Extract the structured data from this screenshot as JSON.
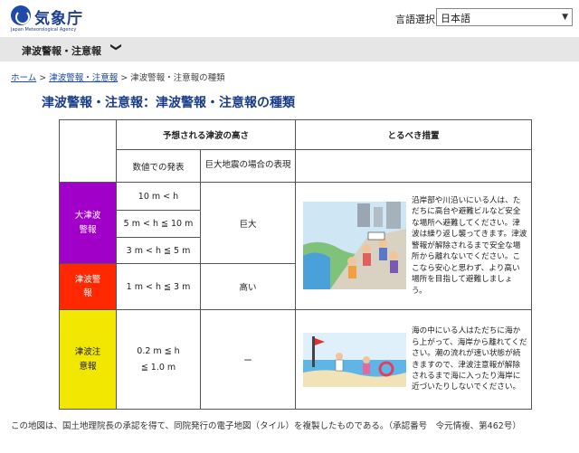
{
  "header": {
    "logo_name": "気象庁",
    "logo_sub": "Japan Meteorological Agency",
    "lang_label": "言語選択",
    "lang_value": "日本語"
  },
  "navbar": {
    "title": "津波警報・注意報",
    "chevron": "❯"
  },
  "breadcrumb": {
    "home": "ホーム",
    "parent": "津波警報・注意報",
    "current": "津波警報・注意報の種類",
    "sep": ">"
  },
  "page_title": "津波警報・注意報：津波警報・注意報の種類",
  "table": {
    "header_height": "予想される津波の高さ",
    "header_action": "とるべき措置",
    "sub_numeric": "数値での発表",
    "sub_giant": "巨大地震の場合の表現",
    "rows": [
      {
        "level": "大津波警報",
        "level_line1": "大津波",
        "level_line2": "警報",
        "ranges": [
          "10 m < h",
          "5 m < h ≦ 10 m",
          "3 m < h ≦ 5 m"
        ],
        "giant": "巨大",
        "action": "沿岸部や川沿いにいる人は、ただちに高台や避難ビルなど安全な場所へ避難してください。津波は繰り返し襲ってきます。津波警報が解除されるまで安全な場所から離れないでください。ここなら安心と思わず、より高い場所を目指して避難しましょう。"
      },
      {
        "level": "津波警報",
        "level_line1": "津波警",
        "level_line2": "報",
        "ranges": [
          "1 m < h ≦ 3 m"
        ],
        "giant": "高い"
      },
      {
        "level": "津波注意報",
        "level_line1": "津波注",
        "level_line2": "意報",
        "ranges": [
          "0.2 m ≦ h",
          "≦ 1.0 m"
        ],
        "giant": "ー",
        "action": "海の中にいる人はただちに海から上がって、海岸から離れてください。潮の流れが速い状態が続きますので、津波注意報が解除されるまで海に入ったり海岸に近づいたりしないでください。"
      }
    ]
  },
  "footer": "この地図は、国土地理院長の承認を得て、同院発行の電子地図（タイル）を複製したものである。（承認番号　令元情複、第462号）",
  "colors": {
    "major_warning": "#a000c8",
    "warning": "#ff2800",
    "advisory": "#f2e700",
    "brand": "#1f3f8f"
  }
}
